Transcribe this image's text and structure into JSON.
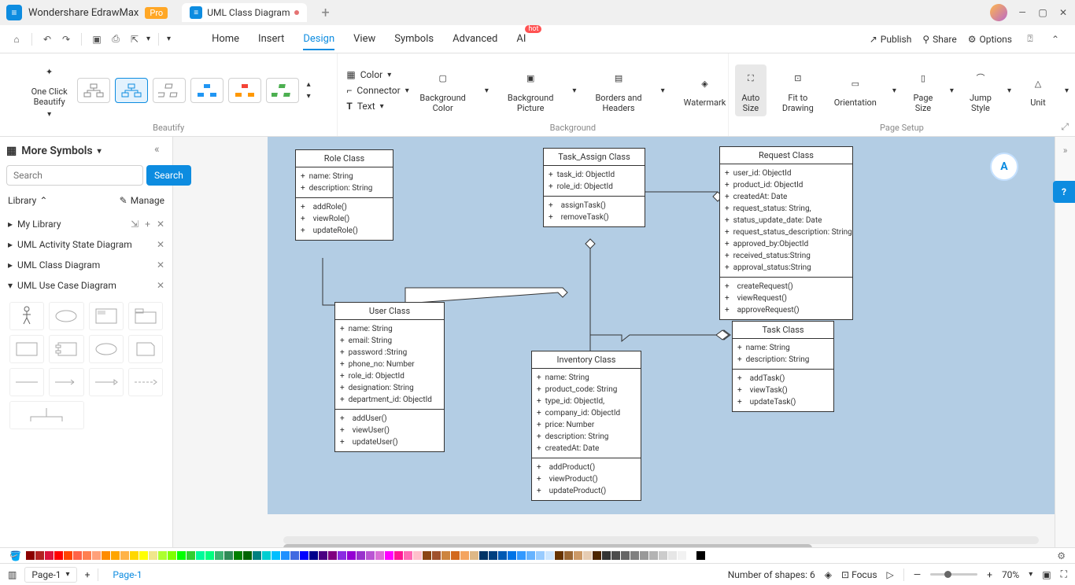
{
  "app": {
    "name": "Wondershare EdrawMax",
    "pro": "Pro"
  },
  "tab": {
    "title": "UML Class Diagram"
  },
  "menu": {
    "items": [
      "Home",
      "Insert",
      "Design",
      "View",
      "Symbols",
      "Advanced",
      "AI"
    ],
    "active": "Design",
    "hot": "hot"
  },
  "qat_right": {
    "publish": "Publish",
    "share": "Share",
    "options": "Options"
  },
  "ribbon": {
    "one_click": "One Click\nBeautify",
    "beautify": "Beautify",
    "color": "Color",
    "connector": "Connector",
    "text": "Text",
    "bg_color": "Background\nColor",
    "bg_picture": "Background\nPicture",
    "borders": "Borders and\nHeaders",
    "watermark": "Watermark",
    "background_group": "Background",
    "auto_size": "Auto\nSize",
    "fit": "Fit to\nDrawing",
    "orientation": "Orientation",
    "page_size": "Page\nSize",
    "jump": "Jump\nStyle",
    "unit": "Unit",
    "page_setup_group": "Page Setup"
  },
  "sidebar": {
    "title": "More Symbols",
    "search_placeholder": "Search",
    "search_btn": "Search",
    "library": "Library",
    "manage": "Manage",
    "sections": [
      "My Library",
      "UML Activity State Diagram",
      "UML Class Diagram",
      "UML Use Case Diagram"
    ],
    "shape_labels": [
      "Actor",
      "",
      "",
      "",
      "",
      "",
      "",
      "",
      "",
      "",
      "",
      ""
    ]
  },
  "uml": {
    "role": {
      "title": "Role Class",
      "attrs": "+  name: String\n+  description: String",
      "methods": "+    addRole()\n+    viewRole()\n+    updateRole()"
    },
    "task_assign": {
      "title": "Task_Assign Class",
      "attrs": "+  task_id: ObjectId\n+  role_id: ObjectId",
      "methods": "+    assignTask()\n+    removeTask()"
    },
    "request": {
      "title": "Request Class",
      "attrs": "+  user_id: ObjectId\n+  product_id: ObjectId\n+  createdAt: Date\n+  request_status: String,\n+  status_update_date: Date\n+  request_status_description: String\n+  approved_by:ObjectId\n+  received_status:String\n+  approval_status:String",
      "methods": "+    createRequest()\n+    viewRequest()\n+    approveRequest()"
    },
    "user": {
      "title": "User Class",
      "attrs": "+  name: String\n+  email: String\n+  password :String\n+  phone_no: Number\n+  role_id: ObjectId\n+  designation: String\n+  department_id: ObjectId",
      "methods": "+    addUser()\n+    viewUser()\n+    updateUser()"
    },
    "inventory": {
      "title": "Inventory Class",
      "attrs": "+  name: String\n+  product_code: String\n+  type_id: ObjectId,\n+  company_id: ObjectId\n+  price: Number\n+  description: String\n+  createdAt: Date",
      "methods": "+    addProduct()\n+    viewProduct()\n+    updateProduct()"
    },
    "task": {
      "title": "Task Class",
      "attrs": "+  name: String\n+  description: String",
      "methods": "+    addTask()\n+    viewTask()\n+    updateTask()"
    }
  },
  "status": {
    "page_selector": "Page-1",
    "page_tab": "Page-1",
    "shape_count": "Number of shapes: 6",
    "focus": "Focus",
    "zoom": "70%"
  },
  "chart_data": {
    "type": "diagram",
    "diagram_type": "uml_class",
    "classes": [
      {
        "name": "Role Class",
        "attributes": [
          "name: String",
          "description: String"
        ],
        "methods": [
          "addRole()",
          "viewRole()",
          "updateRole()"
        ]
      },
      {
        "name": "Task_Assign Class",
        "attributes": [
          "task_id: ObjectId",
          "role_id: ObjectId"
        ],
        "methods": [
          "assignTask()",
          "removeTask()"
        ]
      },
      {
        "name": "Request Class",
        "attributes": [
          "user_id: ObjectId",
          "product_id: ObjectId",
          "createdAt: Date",
          "request_status: String",
          "status_update_date: Date",
          "request_status_description: String",
          "approved_by: ObjectId",
          "received_status: String",
          "approval_status: String"
        ],
        "methods": [
          "createRequest()",
          "viewRequest()",
          "approveRequest()"
        ]
      },
      {
        "name": "User Class",
        "attributes": [
          "name: String",
          "email: String",
          "password: String",
          "phone_no: Number",
          "role_id: ObjectId",
          "designation: String",
          "department_id: ObjectId"
        ],
        "methods": [
          "addUser()",
          "viewUser()",
          "updateUser()"
        ]
      },
      {
        "name": "Inventory Class",
        "attributes": [
          "name: String",
          "product_code: String",
          "type_id: ObjectId",
          "company_id: ObjectId",
          "price: Number",
          "description: String",
          "createdAt: Date"
        ],
        "methods": [
          "addProduct()",
          "viewProduct()",
          "updateProduct()"
        ]
      },
      {
        "name": "Task Class",
        "attributes": [
          "name: String",
          "description: String"
        ],
        "methods": [
          "addTask()",
          "viewTask()",
          "updateTask()"
        ]
      }
    ],
    "relationships": [
      {
        "from": "Role Class",
        "to": "User Class",
        "type": "association"
      },
      {
        "from": "User Class",
        "to": "Task_Assign Class",
        "type": "association"
      },
      {
        "from": "Task_Assign Class",
        "to": "Request Class",
        "type": "aggregation"
      },
      {
        "from": "Task_Assign Class",
        "to": "Inventory Class",
        "type": "aggregation"
      },
      {
        "from": "Task_Assign Class",
        "to": "Task Class",
        "type": "association"
      }
    ]
  }
}
